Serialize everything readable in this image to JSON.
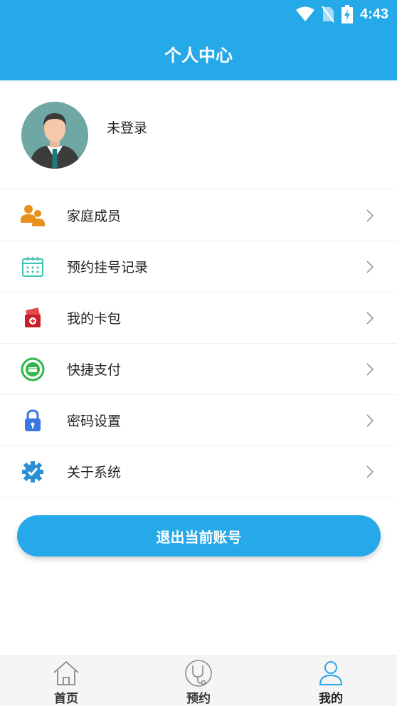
{
  "status_bar": {
    "time": "4:43",
    "icons": [
      "wifi-icon",
      "no-sim-icon",
      "battery-charging-icon"
    ]
  },
  "header": {
    "title": "个人中心"
  },
  "profile": {
    "avatar": "avatar-icon",
    "status": "未登录"
  },
  "menu": {
    "items": [
      {
        "label": "家庭成员",
        "icon": "family-members-icon"
      },
      {
        "label": "预约挂号记录",
        "icon": "calendar-icon"
      },
      {
        "label": "我的卡包",
        "icon": "card-wallet-icon"
      },
      {
        "label": "快捷支付",
        "icon": "quick-pay-icon"
      },
      {
        "label": "密码设置",
        "icon": "lock-icon"
      },
      {
        "label": "关于系统",
        "icon": "gear-check-icon"
      }
    ]
  },
  "logout": {
    "label": "退出当前账号"
  },
  "tabbar": {
    "tabs": [
      {
        "label": "首页",
        "icon": "home-icon",
        "active": false
      },
      {
        "label": "预约",
        "icon": "stethoscope-icon",
        "active": false
      },
      {
        "label": "我的",
        "icon": "user-icon",
        "active": true
      }
    ]
  },
  "colors": {
    "primary": "#26a9e8",
    "active_tab_icon": "#26a9e8"
  }
}
